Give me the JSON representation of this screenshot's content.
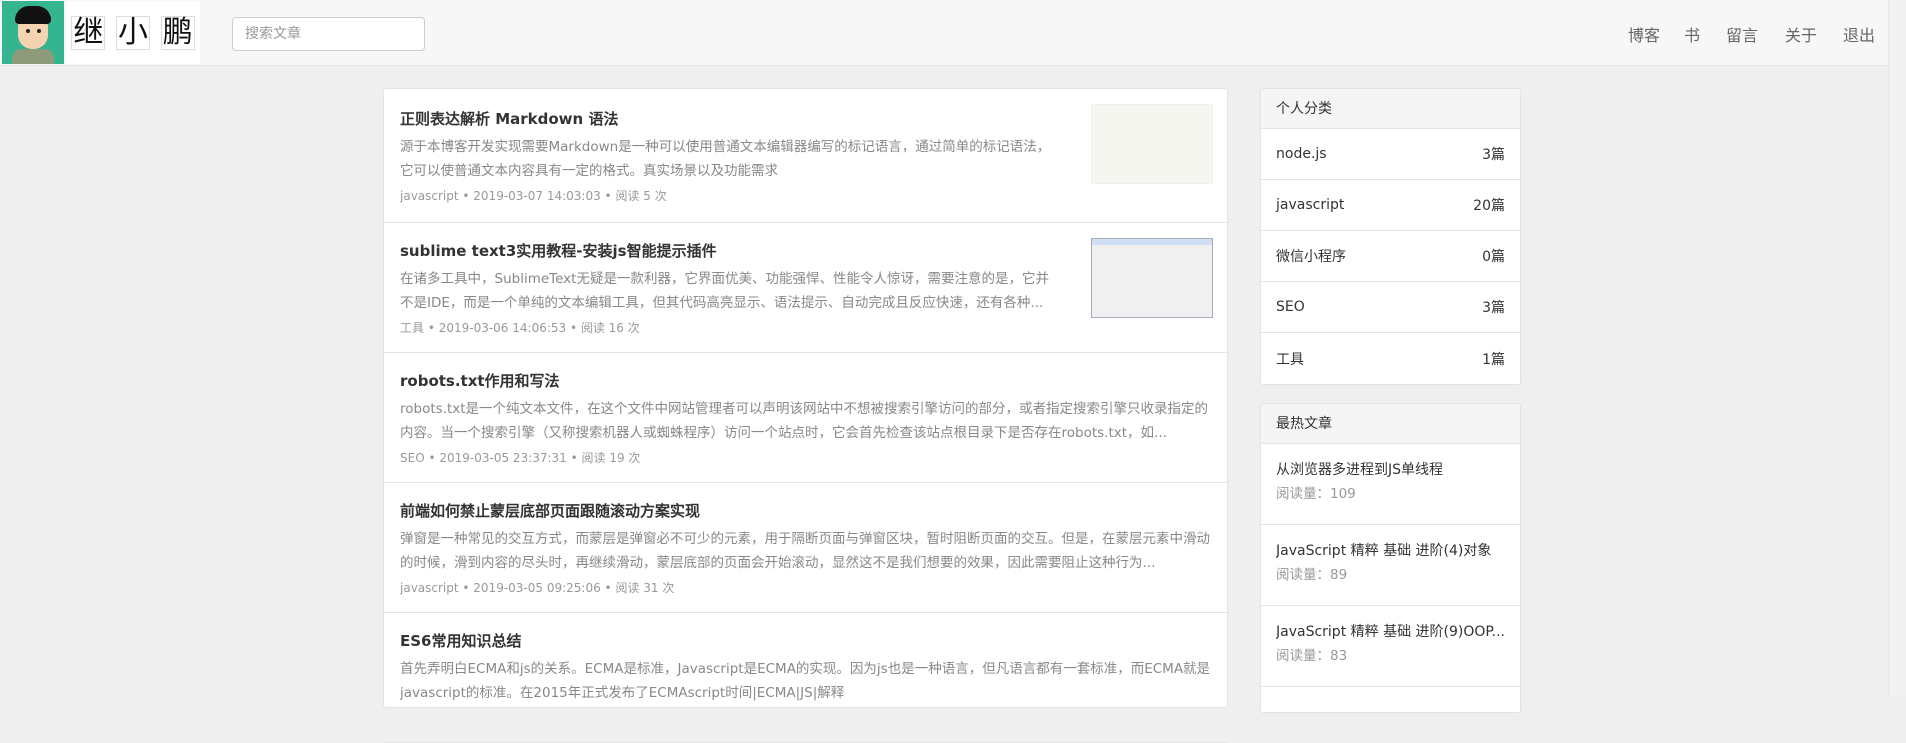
{
  "header": {
    "logo_text": "继小鹏",
    "logo_chars": [
      "继",
      "小",
      "鹏"
    ],
    "search_placeholder": "搜索文章",
    "nav": [
      "博客",
      "书",
      "留言",
      "关于",
      "退出"
    ]
  },
  "posts": [
    {
      "title": "正则表达解析 Markdown 语法",
      "summary": "源于本博客开发实现需要Markdown是一种可以使用普通文本编辑器编写的标记语言，通过简单的标记语法，它可以使普通文本内容具有一定的格式。真实场景以及功能需求",
      "meta": "javascript • 2019-03-07 14:03:03 • 阅读 5 次"
    },
    {
      "title": "sublime text3实用教程-安装js智能提示插件",
      "summary": "在诸多工具中，SublimeText无疑是一款利器，它界面优美、功能强悍、性能令人惊讶，需要注意的是，它并不是IDE，而是一个单纯的文本编辑工具，但其代码高亮显示、语法提示、自动完成且反应快速，还有各种...",
      "meta": "工具 • 2019-03-06 14:06:53 • 阅读 16 次"
    },
    {
      "title": "robots.txt作用和写法",
      "summary": "robots.txt是一个纯文本文件，在这个文件中网站管理者可以声明该网站中不想被搜索引擎访问的部分，或者指定搜索引擎只收录指定的内容。当一个搜索引擎（又称搜索机器人或蜘蛛程序）访问一个站点时，它会首先检查该站点根目录下是否存在robots.txt，如...",
      "meta": "SEO • 2019-03-05 23:37:31 • 阅读 19 次"
    },
    {
      "title": "前端如何禁止蒙层底部页面跟随滚动方案实现",
      "summary": "弹窗是一种常见的交互方式，而蒙层是弹窗必不可少的元素，用于隔断页面与弹窗区块，暂时阻断页面的交互。但是，在蒙层元素中滑动的时候，滑到内容的尽头时，再继续滑动，蒙层底部的页面会开始滚动，显然这不是我们想要的效果，因此需要阻止这种行为...",
      "meta": "javascript • 2019-03-05 09:25:06 • 阅读 31 次"
    },
    {
      "title": "ES6常用知识总结",
      "summary": "首先弄明白ECMA和js的关系。ECMA是标准，Javascript是ECMA的实现。因为js也是一种语言，但凡语言都有一套标准，而ECMA就是javascript的标准。在2015年正式发布了ECMAscript时间|ECMA|JS|解释",
      "meta": ""
    }
  ],
  "categories": {
    "title": "个人分类",
    "items": [
      {
        "name": "node.js",
        "count": "3篇"
      },
      {
        "name": "javascript",
        "count": "20篇"
      },
      {
        "name": "微信小程序",
        "count": "0篇"
      },
      {
        "name": "SEO",
        "count": "3篇"
      },
      {
        "name": "工具",
        "count": "1篇"
      }
    ]
  },
  "hot": {
    "title": "最热文章",
    "items": [
      {
        "title": "从浏览器多进程到JS单线程",
        "reads": "阅读量：109"
      },
      {
        "title": "JavaScript 精粹 基础 进阶(4)对象",
        "reads": "阅读量：89"
      },
      {
        "title": "JavaScript 精粹 基础 进阶(9)OOP...",
        "reads": "阅读量：83"
      }
    ]
  }
}
